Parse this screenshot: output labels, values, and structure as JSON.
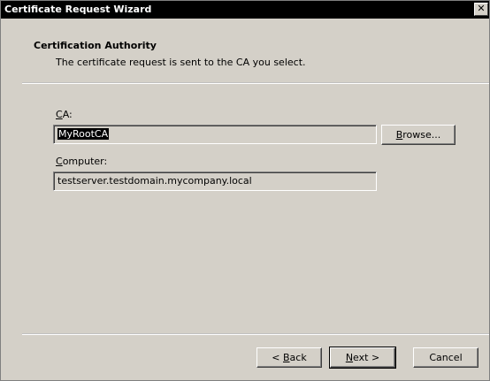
{
  "window": {
    "title": "Certificate Request Wizard",
    "close_glyph": "✕"
  },
  "header": {
    "title": "Certification Authority",
    "description": "The certificate request is sent to the CA you select."
  },
  "form": {
    "ca_label_accel": "C",
    "ca_label_rest": "A:",
    "ca_value": "MyRootCA",
    "browse_accel": "B",
    "browse_rest": "rowse...",
    "computer_label_accel": "C",
    "computer_label_rest": "omputer:",
    "computer_value": "testserver.testdomain.mycompany.local"
  },
  "footer": {
    "back_prefix": "< ",
    "back_accel": "B",
    "back_rest": "ack",
    "next_accel": "N",
    "next_rest": "ext >",
    "cancel_label": "Cancel"
  }
}
